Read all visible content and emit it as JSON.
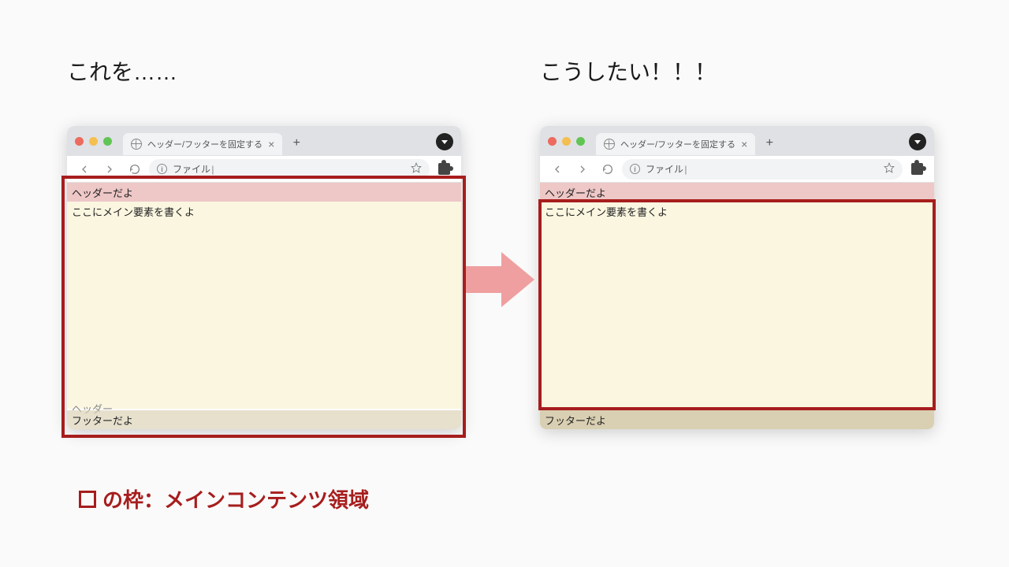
{
  "labels": {
    "left": "これを……",
    "right": "こうしたい！！！"
  },
  "browser": {
    "tab_title": "ヘッダー/フッターを固定する",
    "url_text": "ファイル "
  },
  "page": {
    "header_text": "ヘッダーだよ",
    "main_text": "ここにメイン要素を書くよ",
    "footer_text": "フッターだよ",
    "ghost_header": "ヘッダー"
  },
  "legend": {
    "text": "の枠：メインコンテンツ領域"
  }
}
